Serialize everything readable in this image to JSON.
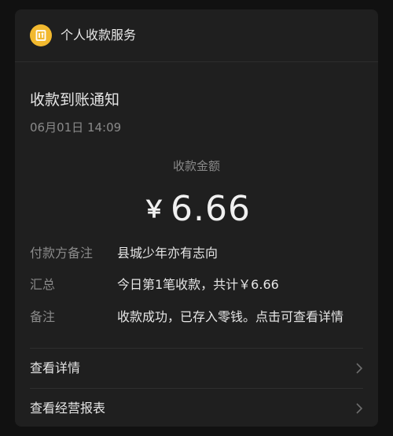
{
  "header": {
    "title": "个人收款服务",
    "icon": "wallet-icon",
    "icon_color": "#f2b92f"
  },
  "notice": {
    "title": "收款到账通知",
    "time": "06月01日 14:09"
  },
  "amount": {
    "label": "收款金额",
    "currency": "￥",
    "value": "6.66"
  },
  "details": [
    {
      "key": "付款方备注",
      "value": "县城少年亦有志向"
    },
    {
      "key": "汇总",
      "value": "今日第1笔收款，共计￥6.66"
    },
    {
      "key": "备注",
      "value": "收款成功，已存入零钱。点击可查看详情"
    }
  ],
  "links": [
    {
      "label": "查看详情",
      "icon": "chevron-right-icon"
    },
    {
      "label": "查看经营报表",
      "icon": "chevron-right-icon"
    }
  ]
}
